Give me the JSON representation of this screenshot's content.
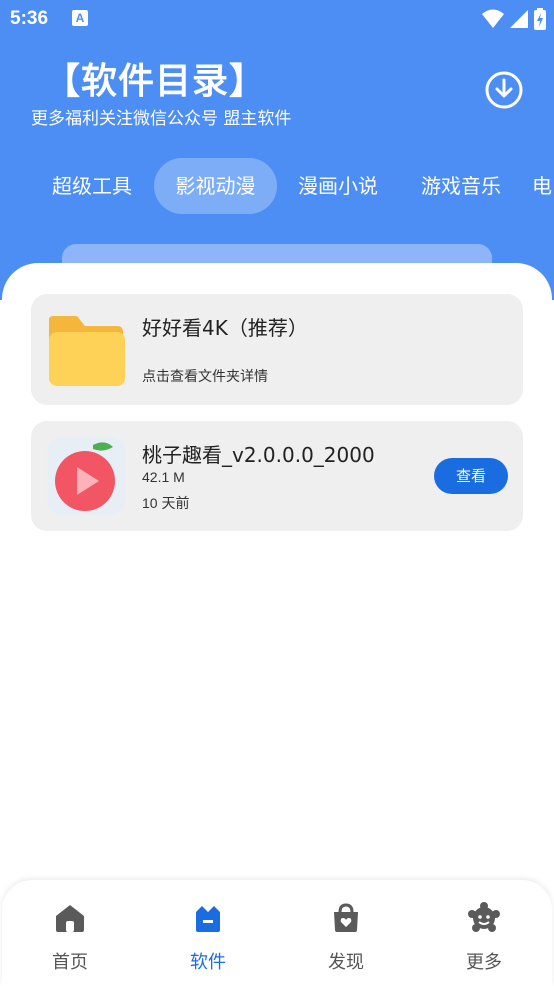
{
  "status_bar": {
    "time": "5:36",
    "notification_icon": "A"
  },
  "header": {
    "title": "【软件目录】",
    "subtitle": "更多福利关注微信公众号 盟主软件",
    "download_icon": "download-icon"
  },
  "tabs": [
    {
      "label": "超级工具",
      "active": false
    },
    {
      "label": "影视动漫",
      "active": true
    },
    {
      "label": "漫画小说",
      "active": false
    },
    {
      "label": "游戏音乐",
      "active": false
    },
    {
      "label": "电",
      "active": false
    }
  ],
  "items": [
    {
      "type": "folder",
      "title": "好好看4K（推荐）",
      "description": "点击查看文件夹详情",
      "icon": "folder-icon"
    },
    {
      "type": "app",
      "title": "桃子趣看_v2.0.0.0_2000",
      "size": "42.1 M",
      "time": "10 天前",
      "button_label": "查看",
      "icon": "peach-play-icon"
    }
  ],
  "bottom_nav": [
    {
      "label": "首页",
      "icon": "home-icon",
      "active": false
    },
    {
      "label": "软件",
      "icon": "software-icon",
      "active": true
    },
    {
      "label": "发现",
      "icon": "discover-icon",
      "active": false
    },
    {
      "label": "更多",
      "icon": "more-icon",
      "active": false
    }
  ],
  "colors": {
    "header_blue": "#4d8ef5",
    "accent_blue": "#1a6de0",
    "card_bg": "#efefef"
  }
}
